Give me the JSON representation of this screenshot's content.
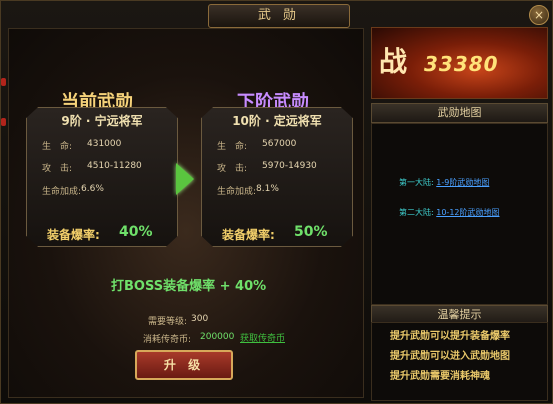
{
  "window": {
    "title": "武 勋",
    "close_glyph": "×"
  },
  "current": {
    "header": "当前武勋",
    "rank": "9阶 · 宁远将军",
    "hp_label": "生　命:",
    "hp_value": "431000",
    "atk_label": "攻　击:",
    "atk_value": "4510-11280",
    "bonus_label": "生命加成:",
    "bonus_value": "6.6%",
    "drop_label": "装备爆率:",
    "drop_value": "40%"
  },
  "next": {
    "header": "下阶武勋",
    "rank": "10阶 · 定远将军",
    "hp_label": "生　命:",
    "hp_value": "567000",
    "atk_label": "攻　击:",
    "atk_value": "5970-14930",
    "bonus_label": "生命加成:",
    "bonus_value": "8.1%",
    "drop_label": "装备爆率:",
    "drop_value": "50%"
  },
  "boss_bonus": "打BOSS装备爆率 + 40%",
  "requirements": {
    "level_label": "需要等级:",
    "level_value": "300",
    "cost_label": "消耗传奇币:",
    "cost_value": "200000",
    "get_link": "获取传奇币"
  },
  "upgrade_button": "升 级",
  "power": {
    "glyph": "战",
    "value": "33380"
  },
  "map": {
    "title": "武勋地图",
    "rows": [
      {
        "label": "第一大陆:",
        "link": "1-9阶武勋地图"
      },
      {
        "label": "第二大陆:",
        "link": "10-12阶武勋地图"
      }
    ]
  },
  "tips": {
    "title": "温馨提示",
    "lines": [
      "提升武勋可以提升装备爆率",
      "提升武勋可以进入武勋地图",
      "提升武勋需要消耗神魂"
    ]
  },
  "colors": {
    "accent_gold": "#f5d27a",
    "next_purple": "#c78cff",
    "bonus_green": "#6fe06a",
    "link_blue": "#4aa0ff"
  }
}
